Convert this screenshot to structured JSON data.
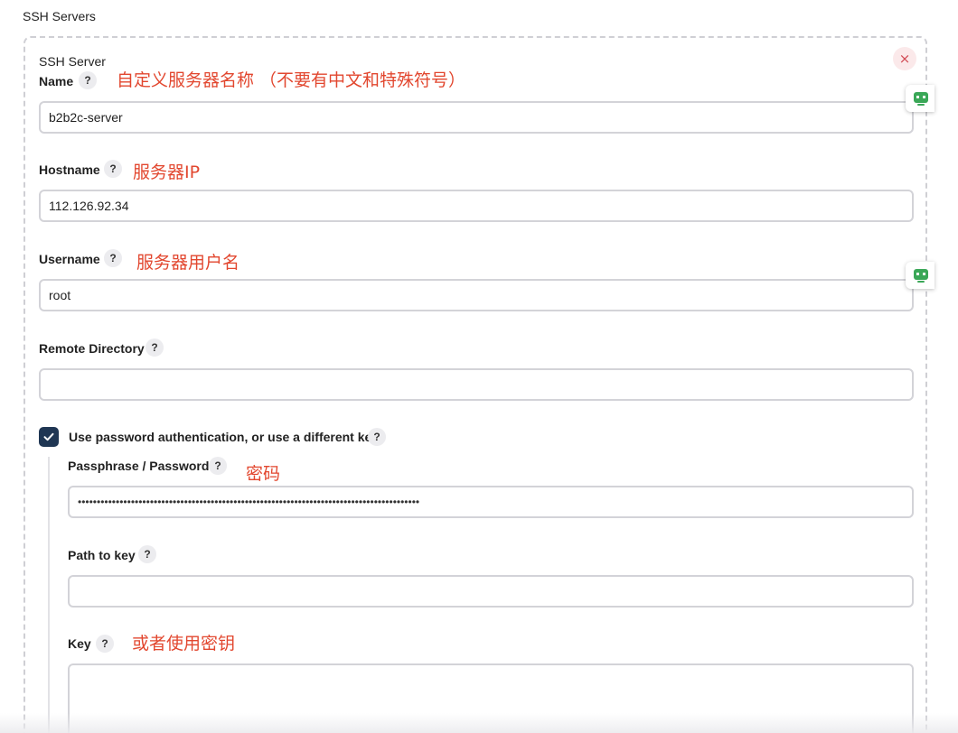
{
  "section_title": "SSH Servers",
  "server": {
    "title": "SSH Server",
    "close_label": "×",
    "name": {
      "label": "Name",
      "help": "?",
      "note": "自定义服务器名称 （不要有中文和特殊符号）",
      "value": "b2b2c-server"
    },
    "hostname": {
      "label": "Hostname",
      "help": "?",
      "note": "服务器IP",
      "value": "112.126.92.34"
    },
    "username": {
      "label": "Username",
      "help": "?",
      "note": "服务器用户名",
      "value": "root"
    },
    "remote_directory": {
      "label": "Remote Directory",
      "help": "?",
      "value": ""
    },
    "use_password": {
      "label": "Use password authentication, or use a different key",
      "help": "?",
      "checked": true
    },
    "passphrase": {
      "label": "Passphrase / Password",
      "help": "?",
      "note": "密码",
      "value": "••••••••••••••••••••••••••••••••••••••••••••••••••••••••••••••••••••••••••••••••••••••••••"
    },
    "path_to_key": {
      "label": "Path to key",
      "help": "?",
      "value": ""
    },
    "key": {
      "label": "Key",
      "help": "?",
      "note": "或者使用密钥",
      "value": ""
    }
  },
  "colors": {
    "annotation": "#e2472f",
    "checkbox": "#1f3653",
    "widget_icon": "#3aa757"
  },
  "icons": {
    "side_widget": "robot-face-icon",
    "close": "close-icon",
    "checkbox": "checkmark-icon"
  }
}
